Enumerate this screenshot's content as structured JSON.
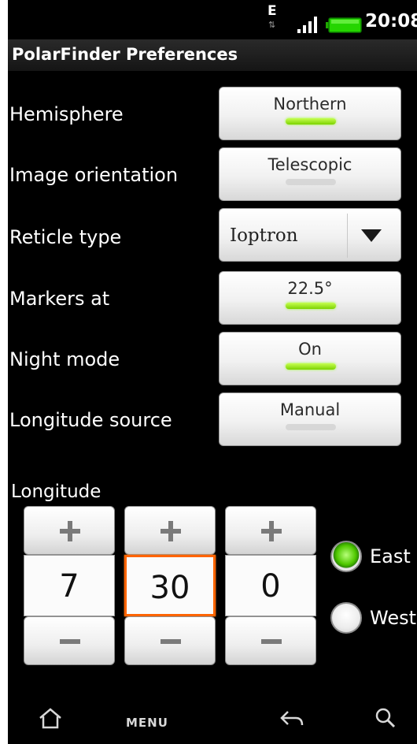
{
  "status_bar": {
    "network_type": "E",
    "clock": "20:08",
    "battery_color": "#25d500"
  },
  "app": {
    "title": "PolarFinder Preferences"
  },
  "preferences": [
    {
      "label": "Hemisphere",
      "value": "Northern",
      "indicator_on": true
    },
    {
      "label": "Image orientation",
      "value": "Telescopic",
      "indicator_on": false
    },
    {
      "label": "Reticle type",
      "value": "Ioptron",
      "control": "dropdown"
    },
    {
      "label": "Markers at",
      "value": "22.5°",
      "indicator_on": true
    },
    {
      "label": "Night mode",
      "value": "On",
      "indicator_on": true
    },
    {
      "label": "Longitude source",
      "value": "Manual",
      "indicator_on": false
    }
  ],
  "longitude": {
    "heading": "Longitude",
    "pickers": [
      {
        "value": "7",
        "focused": false
      },
      {
        "value": "30",
        "focused": true
      },
      {
        "value": "0",
        "focused": false
      }
    ],
    "direction": {
      "options": [
        "East",
        "West"
      ],
      "selected": "East"
    }
  },
  "nav_bar": {
    "menu_label": "MENU",
    "icons": [
      "home-icon",
      "back-icon",
      "search-icon"
    ]
  },
  "colors": {
    "indicator_on": "#7cd300",
    "focus": "#ff6400"
  }
}
